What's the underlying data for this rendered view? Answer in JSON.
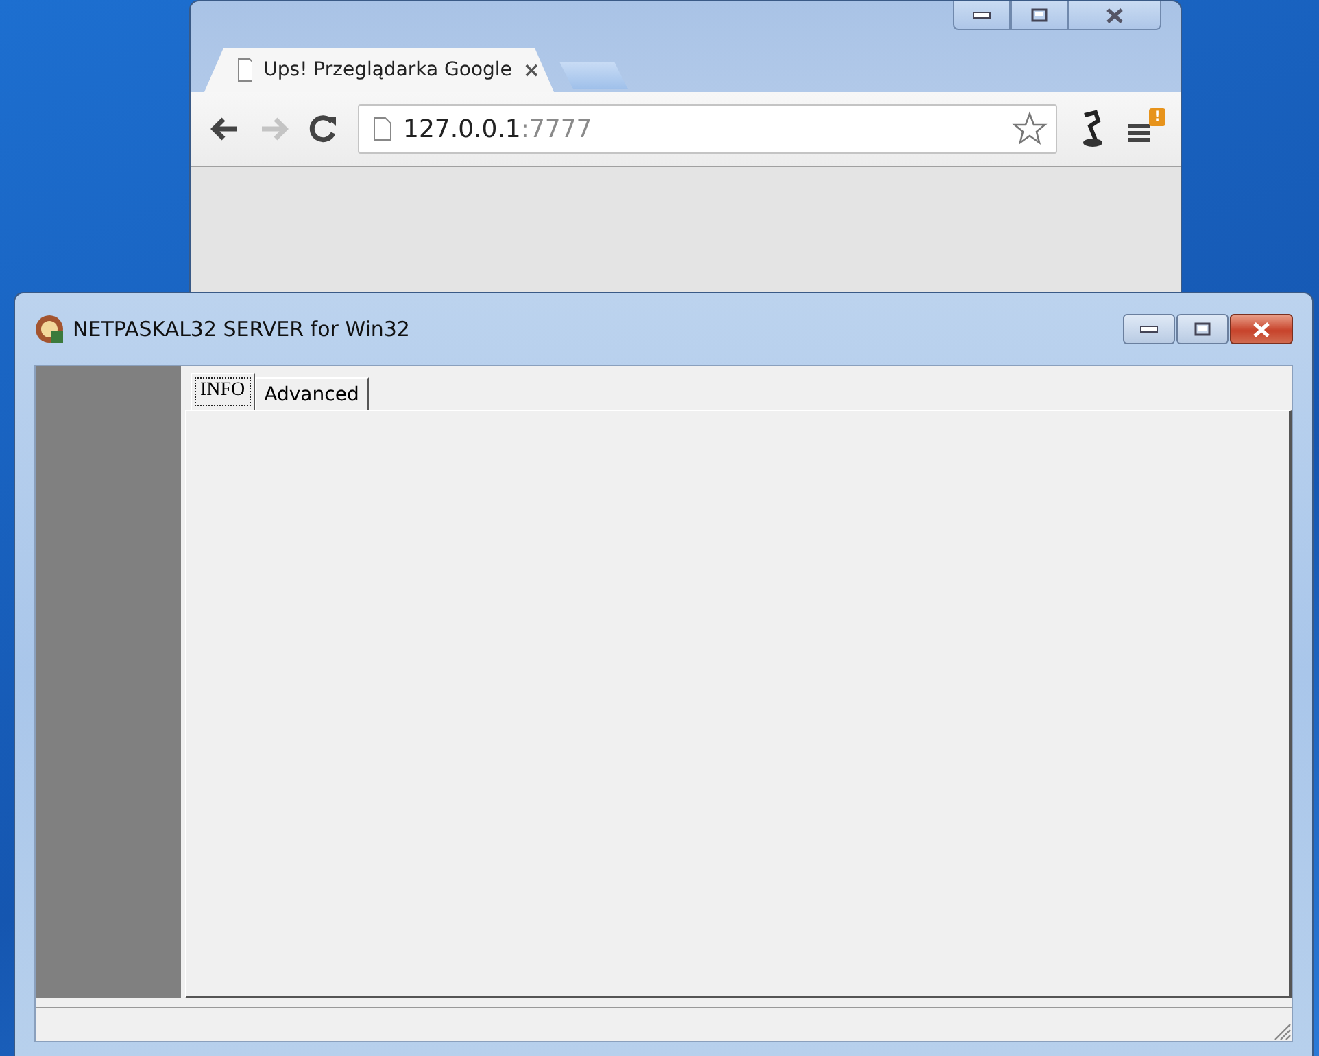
{
  "browser": {
    "tab": {
      "title": "Ups! Przeglądarka Google",
      "close": "×"
    },
    "address": {
      "host": "127.0.0.1",
      "port": ":7777"
    },
    "menu_badge": "!"
  },
  "app": {
    "title": "NETPASKAL32 SERVER for Win32",
    "tabs": [
      {
        "label": "INFO",
        "selected": true
      },
      {
        "label": "Advanced",
        "selected": false
      }
    ]
  }
}
